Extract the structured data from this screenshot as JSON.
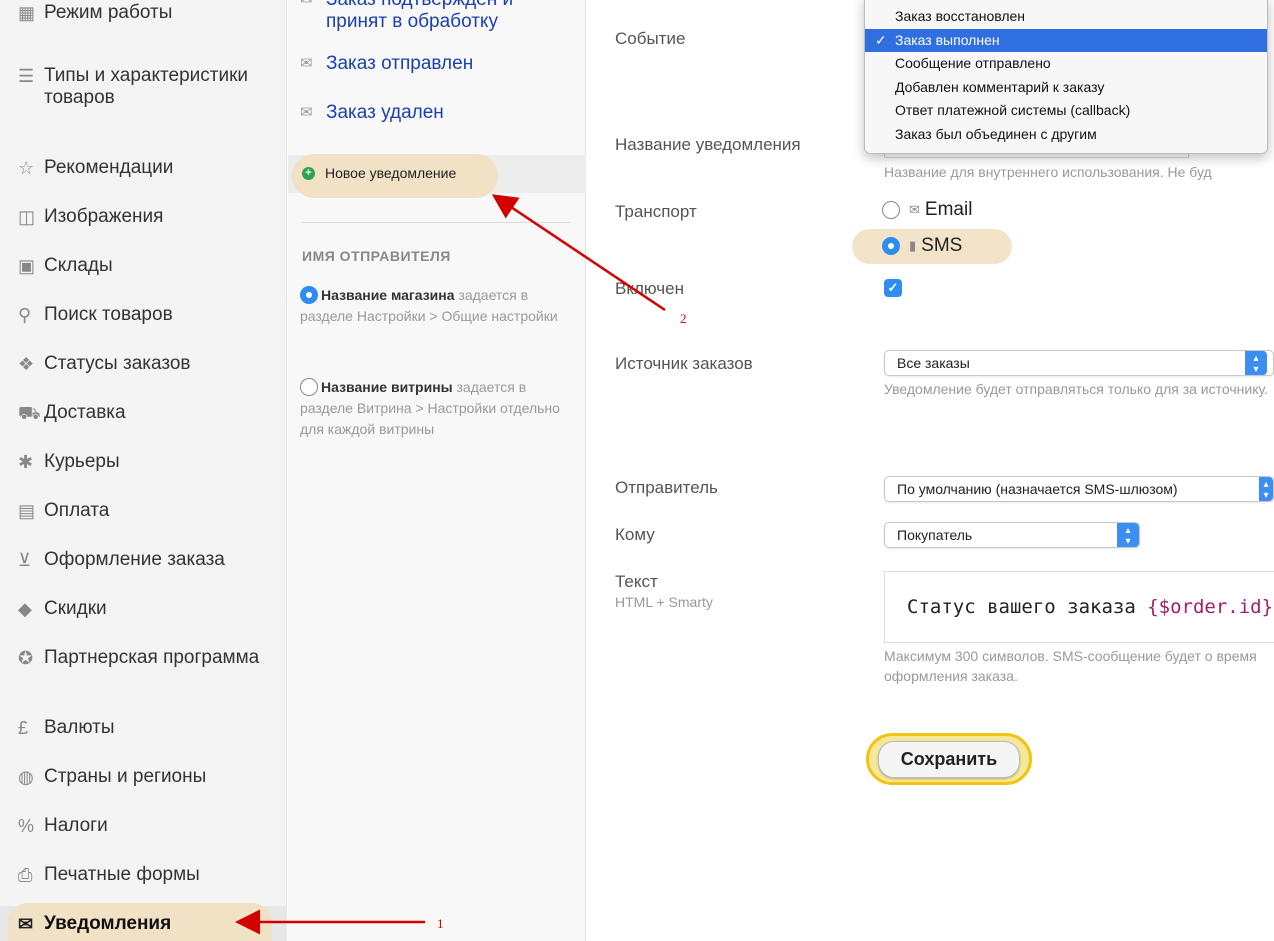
{
  "sidebar": {
    "items": [
      {
        "label": "Режим работы",
        "icon": "calendar-icon"
      },
      {
        "label": "Типы и характеристики товаров",
        "icon": "list-icon"
      },
      {
        "label": "Рекомендации",
        "icon": "star-icon"
      },
      {
        "label": "Изображения",
        "icon": "images-icon"
      },
      {
        "label": "Склады",
        "icon": "box-icon"
      },
      {
        "label": "Поиск товаров",
        "icon": "search-icon"
      },
      {
        "label": "Статусы заказов",
        "icon": "tags-icon"
      },
      {
        "label": "Доставка",
        "icon": "truck-icon"
      },
      {
        "label": "Курьеры",
        "icon": "runner-icon"
      },
      {
        "label": "Оплата",
        "icon": "wallet-icon"
      },
      {
        "label": "Оформление заказа",
        "icon": "cart-icon"
      },
      {
        "label": "Скидки",
        "icon": "tag-icon"
      },
      {
        "label": "Партнерская программа",
        "icon": "award-icon"
      },
      {
        "label": "Валюты",
        "icon": "pound-icon"
      },
      {
        "label": "Страны и регионы",
        "icon": "globe-icon"
      },
      {
        "label": "Налоги",
        "icon": "percent-icon"
      },
      {
        "label": "Печатные формы",
        "icon": "printer-icon"
      },
      {
        "label": "Уведомления",
        "icon": "envelope-icon",
        "active": true
      }
    ]
  },
  "notifications": {
    "items": [
      {
        "label": "Заказ подтвержден и принят в обработку"
      },
      {
        "label": "Заказ отправлен"
      },
      {
        "label": "Заказ удален"
      }
    ],
    "new_label": "Новое уведомление"
  },
  "sender": {
    "heading": "ИМЯ ОТПРАВИТЕЛЯ",
    "options": [
      {
        "title": "Название магазина",
        "desc": " задается в разделе Настройки > Общие настройки",
        "selected": true
      },
      {
        "title": "Название витрины",
        "desc": " задается в разделе Витрина > Настройки отдельно для каждой витрины",
        "selected": false
      }
    ]
  },
  "form": {
    "event_label": "Событие",
    "name_label": "Название уведомления",
    "name_hint": "Название для внутреннего использования. Не буд",
    "transport_label": "Транспорт",
    "transport_options": [
      "Email",
      "SMS"
    ],
    "transport_selected": "SMS",
    "enabled_label": "Включен",
    "enabled_checked": true,
    "source_label": "Источник заказов",
    "source_value": "Все заказы",
    "source_hint": "Уведомление будет отправляться только для за источнику.",
    "from_label": "Отправитель",
    "from_value": "По умолчанию (назначается SMS-шлюзом)",
    "to_label": "Кому",
    "to_value": "Покупатель",
    "text_label": "Текст",
    "text_sublabel": "HTML + Smarty",
    "text_value_prefix": "Статус вашего заказа ",
    "text_value_var": "{$order.id}",
    "text_hint": "Максимум 300 символов. SMS-сообщение будет о время оформления заказа.",
    "save_label": "Сохранить"
  },
  "event_dropdown": {
    "options": [
      "Заказ восстановлен",
      "Заказ выполнен",
      "Сообщение отправлено",
      "Добавлен комментарий к заказу",
      "Ответ платежной системы (callback)",
      "Заказ был объединен с другим"
    ],
    "selected": "Заказ выполнен",
    "check_mark": "✓"
  },
  "annotations": {
    "label_1": "1",
    "label_2": "2"
  },
  "colors": {
    "accent": "#2f8df0",
    "highlight": "#f1e2c6",
    "arrow": "#d40000",
    "link": "#1a3fb0"
  }
}
